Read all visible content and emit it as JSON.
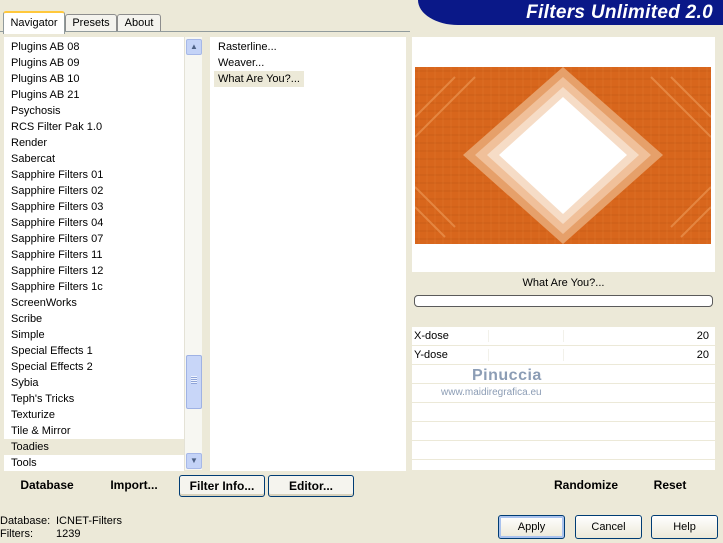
{
  "tabs": [
    "Navigator",
    "Presets",
    "About"
  ],
  "banner_title": "Filters Unlimited 2.0",
  "categories": [
    "Plugins AB 08",
    "Plugins AB 09",
    "Plugins AB 10",
    "Plugins AB 21",
    "Psychosis",
    "RCS Filter Pak 1.0",
    "Render",
    "Sabercat",
    "Sapphire Filters 01",
    "Sapphire Filters 02",
    "Sapphire Filters 03",
    "Sapphire Filters 04",
    "Sapphire Filters 07",
    "Sapphire Filters 11",
    "Sapphire Filters 12",
    "Sapphire Filters 1c",
    "ScreenWorks",
    "Scribe",
    "Simple",
    "Special Effects 1",
    "Special Effects 2",
    "Sybia",
    "Teph's Tricks",
    "Texturize",
    "Tile & Mirror",
    "Toadies",
    "Tools"
  ],
  "selected_category": "Toadies",
  "filters": [
    "Rasterline...",
    "Weaver...",
    "What Are You?..."
  ],
  "selected_filter": "What Are You?...",
  "filter_name": "What Are You?...",
  "params": [
    {
      "label": "X-dose",
      "value": "20"
    },
    {
      "label": "Y-dose",
      "value": "20"
    }
  ],
  "watermark": {
    "name": "Pinuccia",
    "site": "www.maidiregrafica.eu"
  },
  "buttons": {
    "database": "Database",
    "import": "Import...",
    "filter_info": "Filter Info...",
    "editor": "Editor...",
    "randomize": "Randomize",
    "reset": "Reset",
    "apply": "Apply",
    "cancel": "Cancel",
    "help": "Help"
  },
  "status": {
    "database_label": "Database:",
    "database_value": "ICNET-Filters",
    "filters_label": "Filters:",
    "filters_value": "1239"
  },
  "colors": {
    "banner": "#0a1888",
    "preview_orange": "#d8661c",
    "selection": "#ece9d8"
  },
  "icons": [
    "scroll-up-icon",
    "scroll-down-icon"
  ]
}
